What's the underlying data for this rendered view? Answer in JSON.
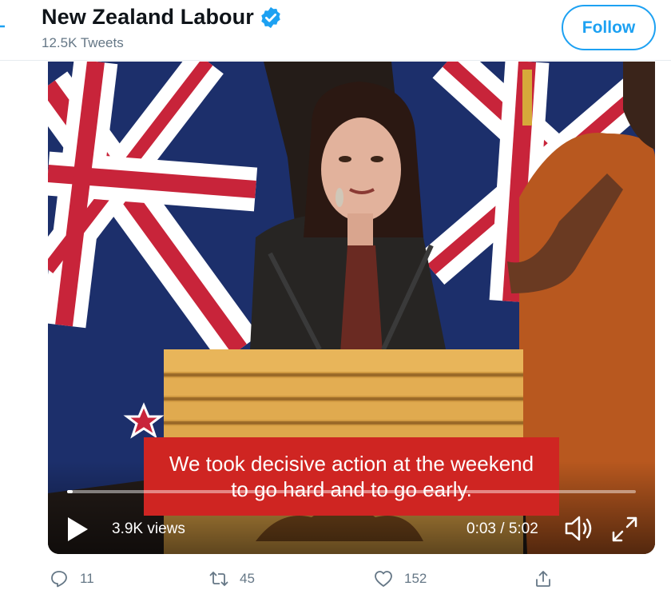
{
  "header": {
    "title": "New Zealand Labour",
    "tweet_count": "12.5K Tweets",
    "follow_label": "Follow"
  },
  "video": {
    "caption_lines": [
      "We took decisive action at the weekend",
      "to go hard and to go early."
    ],
    "views": "3.9K views",
    "time": "0:03 / 5:02",
    "progress": 0.01
  },
  "actions": {
    "replies": "11",
    "retweets": "45",
    "likes": "152"
  },
  "colors": {
    "accent": "#1da1f2",
    "caption_bg": "#cf2522",
    "muted_text": "#657786"
  },
  "icons": [
    "back-arrow-icon",
    "verified-badge-icon",
    "play-icon",
    "volume-icon",
    "fullscreen-icon",
    "reply-icon",
    "retweet-icon",
    "like-icon",
    "share-icon"
  ]
}
